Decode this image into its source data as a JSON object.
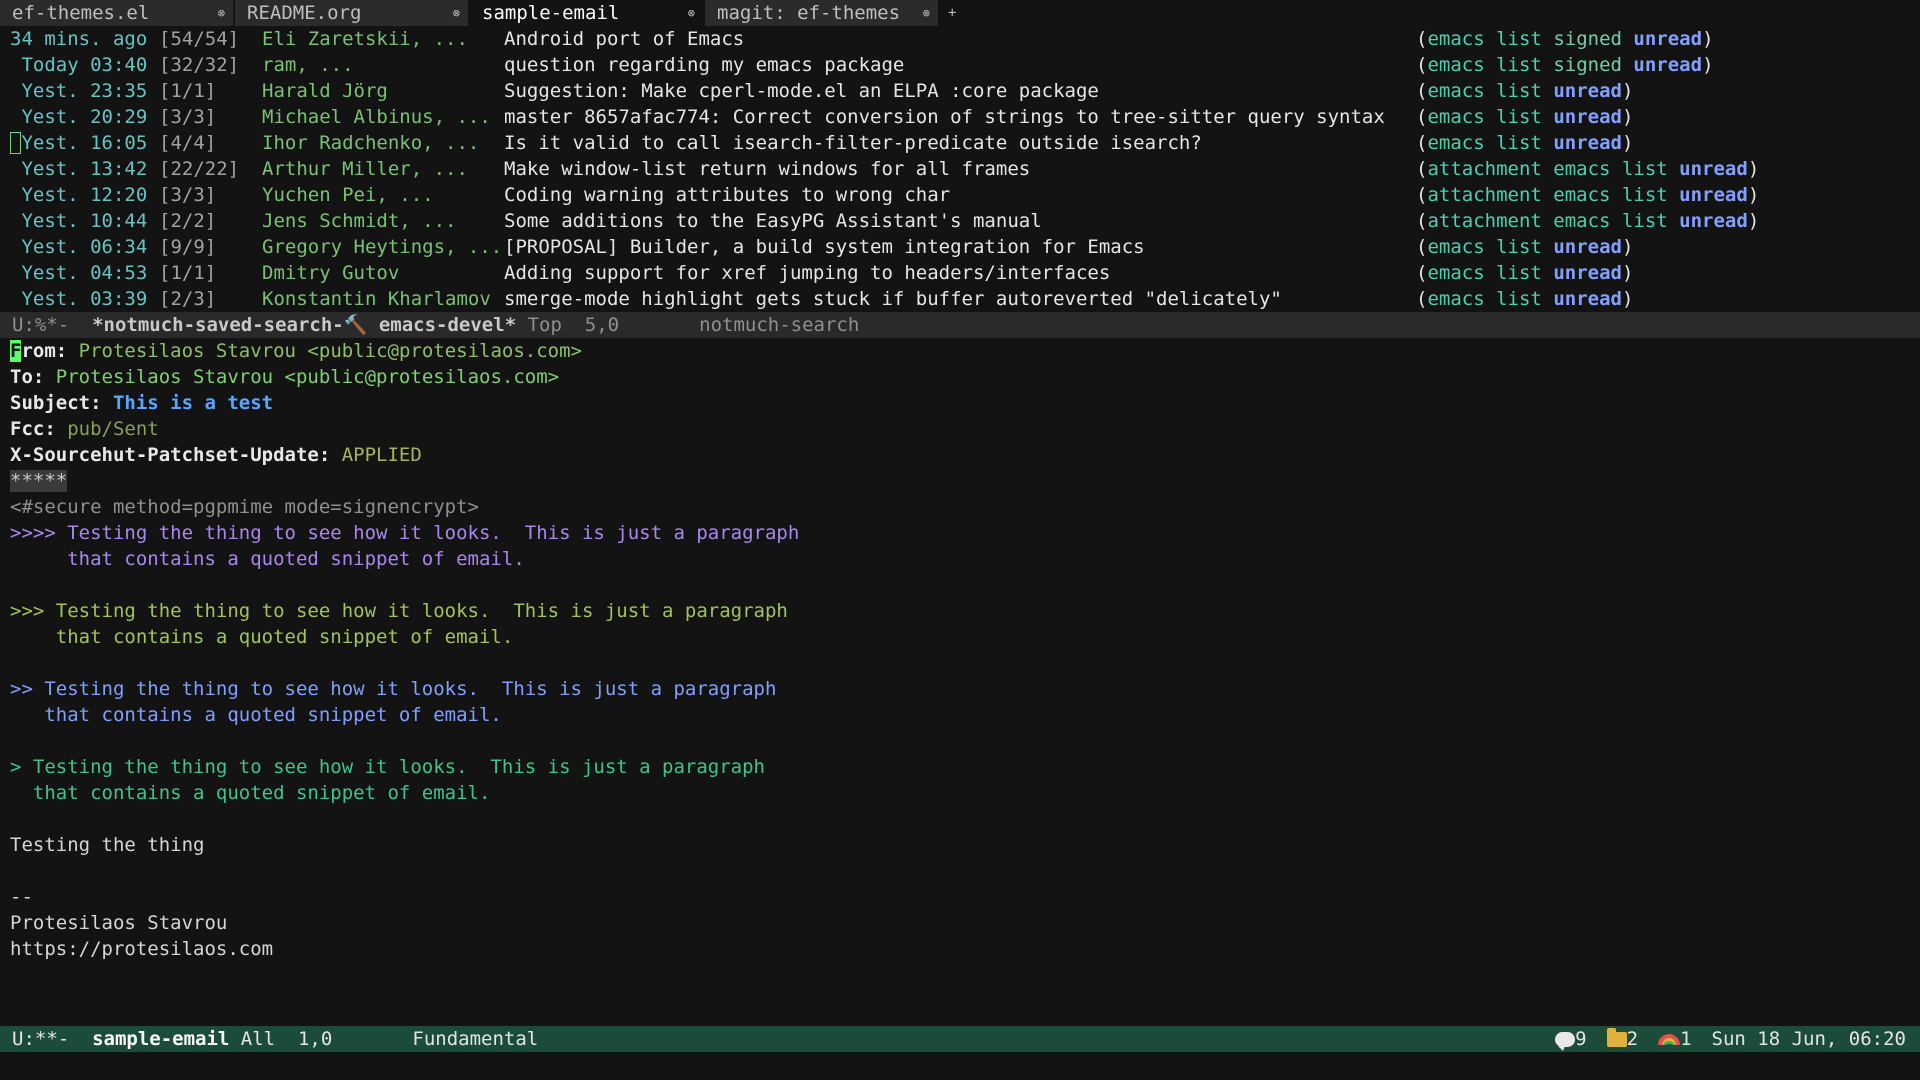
{
  "tabs": [
    {
      "label": "ef-themes.el",
      "close": "⊗"
    },
    {
      "label": "README.org",
      "close": "⊗"
    },
    {
      "label": "sample-email",
      "close": "⊗"
    },
    {
      "label": "magit: ef-themes",
      "close": "⊗"
    }
  ],
  "new_tab": "+",
  "search_rows": [
    {
      "date": "34 mins. ago",
      "count": "[54/54]",
      "authors": "Eli Zaretskii, ...",
      "subject": "Android port of Emacs",
      "tags": [
        "emacs",
        "list",
        "signed",
        "unread"
      ]
    },
    {
      "date": " Today 03:40",
      "count": "[32/32]",
      "authors": "ram, ...",
      "subject": "question regarding my emacs package",
      "tags": [
        "emacs",
        "list",
        "signed",
        "unread"
      ]
    },
    {
      "date": " Yest. 23:35",
      "count": "[1/1]",
      "authors": "Harald Jörg",
      "subject": "Suggestion: Make cperl-mode.el an ELPA :core package",
      "tags": [
        "emacs",
        "list",
        "unread"
      ]
    },
    {
      "date": " Yest. 20:29",
      "count": "[3/3]",
      "authors": "Michael Albinus, ...",
      "subject": "master 8657afac774: Correct conversion of strings to tree-sitter query syntax",
      "tags": [
        "emacs",
        "list",
        "unread"
      ]
    },
    {
      "date": " Yest. 16:05",
      "count": "[4/4]",
      "authors": "Ihor Radchenko, ...",
      "subject": "Is it valid to call isearch-filter-predicate outside isearch?",
      "tags": [
        "emacs",
        "list",
        "unread"
      ]
    },
    {
      "date": " Yest. 13:42",
      "count": "[22/22]",
      "authors": "Arthur Miller, ...",
      "subject": "Make window-list return windows for all frames",
      "tags": [
        "attachment",
        "emacs",
        "list",
        "unread"
      ]
    },
    {
      "date": " Yest. 12:20",
      "count": "[3/3]",
      "authors": "Yuchen Pei, ...",
      "subject": "Coding warning attributes to wrong char",
      "tags": [
        "attachment",
        "emacs",
        "list",
        "unread"
      ]
    },
    {
      "date": " Yest. 10:44",
      "count": "[2/2]",
      "authors": "Jens Schmidt, ...",
      "subject": "Some additions to the EasyPG Assistant's manual",
      "tags": [
        "attachment",
        "emacs",
        "list",
        "unread"
      ]
    },
    {
      "date": " Yest. 06:34",
      "count": "[9/9]",
      "authors": "Gregory Heytings, ...",
      "subject": "[PROPOSAL] Builder, a build system integration for Emacs",
      "tags": [
        "emacs",
        "list",
        "unread"
      ]
    },
    {
      "date": " Yest. 04:53",
      "count": "[1/1]",
      "authors": "Dmitry Gutov",
      "subject": "Adding support for xref jumping to headers/interfaces",
      "tags": [
        "emacs",
        "list",
        "unread"
      ]
    },
    {
      "date": " Yest. 03:39",
      "count": "[2/3]",
      "authors": "Konstantin Kharlamov",
      "subject": "smerge-mode highlight gets stuck if buffer autoreverted \"delicately\"",
      "tags": [
        "emacs",
        "list",
        "unread"
      ]
    }
  ],
  "modeline_top": {
    "state": "U:%*-  ",
    "buffer": "*notmuch-saved-search-",
    "hammer": "🔨",
    "buffer2": " emacs-devel*",
    "pos": " Top  5,0",
    "mode": "       notmuch-search"
  },
  "email": {
    "from_key": "From:",
    "from_val": " Protesilaos Stavrou <public@protesilaos.com>",
    "to_key": "To:",
    "to_val": " Protesilaos Stavrou <public@protesilaos.com>",
    "subject_key": "Subject:",
    "subject_val": " This is a test",
    "fcc_key": "Fcc:",
    "fcc_val": " pub/Sent",
    "xs_key": "X-Sourcehut-Patchset-Update:",
    "xs_val": " APPLIED",
    "separator": "*****",
    "secure": "<#secure method=pgpmime mode=signencrypt>",
    "q4_1": ">>>> Testing the thing to see how it looks.  This is just a paragraph",
    "q4_2": "     that contains a quoted snippet of email.",
    "q3_1": ">>> Testing the thing to see how it looks.  This is just a paragraph",
    "q3_2": "    that contains a quoted snippet of email.",
    "q2_1": ">> Testing the thing to see how it looks.  This is just a paragraph",
    "q2_2": "   that contains a quoted snippet of email.",
    "q1_1": "> Testing the thing to see how it looks.  This is just a paragraph",
    "q1_2": "  that contains a quoted snippet of email.",
    "body": "Testing the thing",
    "sig_sep": "--",
    "sig_name": "Protesilaos Stavrou",
    "sig_url": "https://protesilaos.com"
  },
  "modeline_bottom": {
    "state": "U:**-  ",
    "buffer": "sample-email",
    "pos": " All  1,0",
    "mode": "       Fundamental",
    "msg_count": "9",
    "folder_count": "2",
    "rainbow_count": "1",
    "datetime": "Sun 18 Jun, 06:20"
  },
  "colors": {
    "background": "#131313",
    "modeline_active": "#1b4c3a",
    "modeline_inactive": "#2a2a2a",
    "unread": "#82a0ff",
    "tag": "#49d1b0"
  }
}
